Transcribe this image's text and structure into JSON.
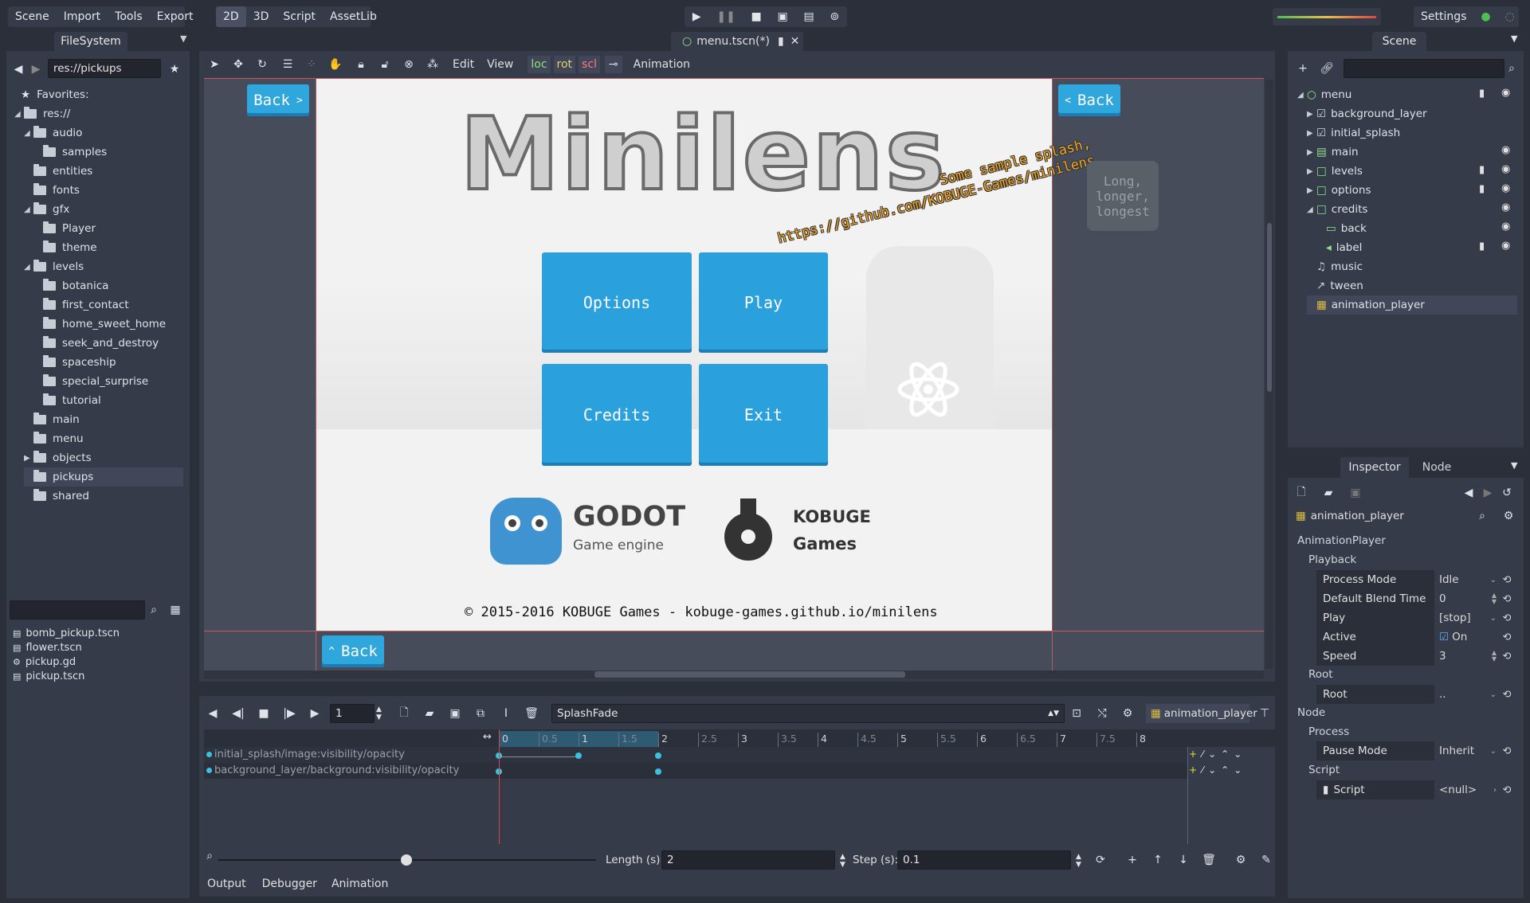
{
  "menu": {
    "items": [
      "Scene",
      "Import",
      "Tools",
      "Export"
    ]
  },
  "modes": {
    "items": [
      "2D",
      "3D",
      "Script",
      "AssetLib"
    ],
    "active": "2D"
  },
  "playback_icons": [
    "play-icon",
    "pause-icon",
    "stop-icon",
    "play-scene-icon",
    "play-custom-icon",
    "remote-debug-icon"
  ],
  "settings_label": "Settings",
  "filesystem": {
    "title": "FileSystem",
    "path": "res://pickups",
    "favorites": "Favorites:",
    "tree": [
      {
        "label": "res://",
        "indent": 0,
        "arrow": "◢"
      },
      {
        "label": "audio",
        "indent": 1,
        "arrow": "◢"
      },
      {
        "label": "samples",
        "indent": 2,
        "arrow": ""
      },
      {
        "label": "entities",
        "indent": 1,
        "arrow": ""
      },
      {
        "label": "fonts",
        "indent": 1,
        "arrow": ""
      },
      {
        "label": "gfx",
        "indent": 1,
        "arrow": "◢"
      },
      {
        "label": "Player",
        "indent": 2,
        "arrow": ""
      },
      {
        "label": "theme",
        "indent": 2,
        "arrow": ""
      },
      {
        "label": "levels",
        "indent": 1,
        "arrow": "◢"
      },
      {
        "label": "botanica",
        "indent": 2,
        "arrow": ""
      },
      {
        "label": "first_contact",
        "indent": 2,
        "arrow": ""
      },
      {
        "label": "home_sweet_home",
        "indent": 2,
        "arrow": ""
      },
      {
        "label": "seek_and_destroy",
        "indent": 2,
        "arrow": ""
      },
      {
        "label": "spaceship",
        "indent": 2,
        "arrow": ""
      },
      {
        "label": "special_surprise",
        "indent": 2,
        "arrow": ""
      },
      {
        "label": "tutorial",
        "indent": 2,
        "arrow": ""
      },
      {
        "label": "main",
        "indent": 1,
        "arrow": ""
      },
      {
        "label": "menu",
        "indent": 1,
        "arrow": ""
      },
      {
        "label": "objects",
        "indent": 1,
        "arrow": "▶"
      },
      {
        "label": "pickups",
        "indent": 1,
        "arrow": "",
        "selected": true
      },
      {
        "label": "shared",
        "indent": 1,
        "arrow": ""
      }
    ],
    "files": [
      "bomb_pickup.tscn",
      "flower.tscn",
      "pickup.gd",
      "pickup.tscn"
    ]
  },
  "scene_tab": "menu.tscn(*)",
  "viewport_toolbar": {
    "edit": "Edit",
    "view": "View",
    "loc": "loc",
    "rot": "rot",
    "scl": "scl",
    "animation": "Animation"
  },
  "game": {
    "back_label": "Back",
    "title": "Minilens",
    "splash": "Some sample splash,",
    "splash_url": "https://github.com/KOBUGE-Games/minilens",
    "long_text": "Long, longer, longest",
    "options": "Options",
    "play": "Play",
    "credits": "Credits",
    "exit": "Exit",
    "godot": "GODOT",
    "godot_sub": "Game engine",
    "kobuge": "KOBUGE",
    "kobuge_sub": "Games",
    "copyright": "© 2015-2016 KOBUGE Games - kobuge-games.github.io/minilens"
  },
  "scene_tree": {
    "title": "Scene",
    "nodes": [
      {
        "label": "menu",
        "indent": 0
      },
      {
        "label": "background_layer",
        "indent": 1
      },
      {
        "label": "initial_splash",
        "indent": 1
      },
      {
        "label": "main",
        "indent": 1
      },
      {
        "label": "levels",
        "indent": 1
      },
      {
        "label": "options",
        "indent": 1
      },
      {
        "label": "credits",
        "indent": 1
      },
      {
        "label": "back",
        "indent": 2
      },
      {
        "label": "label",
        "indent": 2
      },
      {
        "label": "music",
        "indent": 1
      },
      {
        "label": "tween",
        "indent": 1
      },
      {
        "label": "animation_player",
        "indent": 1,
        "selected": true
      }
    ]
  },
  "inspector": {
    "tabs": [
      "Inspector",
      "Node"
    ],
    "object": "animation_player",
    "class": "AnimationPlayer",
    "playback": "Playback",
    "props": [
      {
        "label": "Process Mode",
        "value": "Idle"
      },
      {
        "label": "Default Blend Time",
        "value": "0"
      },
      {
        "label": "Play",
        "value": "[stop]"
      },
      {
        "label": "Active",
        "value": "On"
      },
      {
        "label": "Speed",
        "value": "3"
      }
    ],
    "root_section": "Root",
    "root_prop": {
      "label": "Root",
      "value": ".."
    },
    "node_section": "Node",
    "process_section": "Process",
    "pause_prop": {
      "label": "Pause Mode",
      "value": "Inherit"
    },
    "script_section": "Script",
    "script_prop": {
      "label": "Script",
      "value": "<null>"
    }
  },
  "animation": {
    "frame": "1",
    "name": "SplashFade",
    "player": "animation_player",
    "ticks": [
      "0",
      "0.5",
      "1",
      "1.5",
      "2",
      "2.5",
      "3",
      "3.5",
      "4",
      "4.5",
      "5",
      "5.5",
      "6",
      "6.5",
      "7",
      "7.5",
      "8"
    ],
    "tracks": [
      "initial_splash/image:visibility/opacity",
      "background_layer/background:visibility/opacity"
    ],
    "length_label": "Length (s):",
    "length": "2",
    "step_label": "Step (s):",
    "step": "0.1"
  },
  "bottom_tabs": [
    "Output",
    "Debugger",
    "Animation"
  ]
}
